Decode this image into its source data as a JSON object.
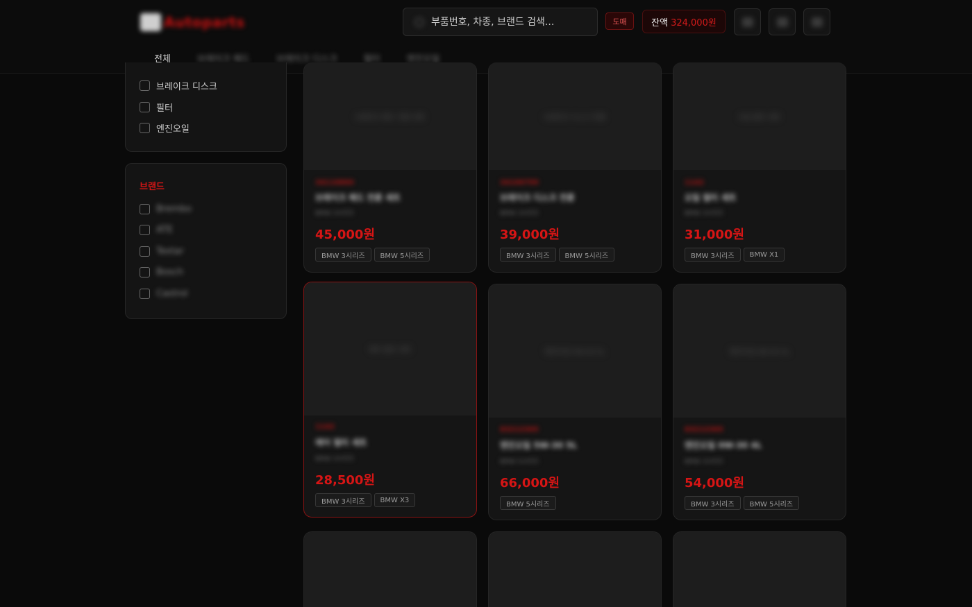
{
  "header": {
    "logo_mark": "XX",
    "logo_text": "Autoparts",
    "search_placeholder": "부품번호, 차종, 브랜드 검색...",
    "wholesale_badge": "도매",
    "balance_label": "잔액",
    "balance_value": "324,000원",
    "icon_buttons": [
      "cart-icon",
      "bell-icon",
      "user-icon"
    ]
  },
  "nav": {
    "tabs": [
      {
        "label": "전체",
        "blurred": false
      },
      {
        "label": "브레이크 패드",
        "blurred": true
      },
      {
        "label": "브레이크 디스크",
        "blurred": true
      },
      {
        "label": "필터",
        "blurred": true
      },
      {
        "label": "엔진오일",
        "blurred": true
      }
    ]
  },
  "sidebar": {
    "categories": [
      {
        "label": "브레이크 디스크"
      },
      {
        "label": "필터"
      },
      {
        "label": "엔진오일"
      }
    ],
    "brand_title": "브랜드",
    "brands": [
      {
        "label": "Brembo"
      },
      {
        "label": "ATE"
      },
      {
        "label": "Textar"
      },
      {
        "label": "Bosch"
      },
      {
        "label": "Castrol"
      }
    ]
  },
  "products": [
    {
      "sku": "34116860",
      "title": "브레이크 패드 전륜 세트",
      "sub": "BMW 3시리즈",
      "price": "45,000원",
      "tags": [
        "BMW 3시리즈",
        "BMW 5시리즈"
      ]
    },
    {
      "sku": "34106799",
      "title": "브레이크 디스크 전륜",
      "sub": "BMW 3시리즈",
      "price": "39,000원",
      "tags": [
        "BMW 3시리즈",
        "BMW 5시리즈"
      ]
    },
    {
      "sku": "1142",
      "title": "오일 필터 세트",
      "sub": "BMW 3시리즈",
      "price": "31,000원",
      "tags": [
        "BMW 3시리즈",
        "BMW X1"
      ]
    },
    {
      "sku": "1142",
      "title": "에어 필터 세트",
      "sub": "BMW 3시리즈",
      "price": "28,500원",
      "tags": [
        "BMW 3시리즈",
        "BMW X3"
      ],
      "selected": true
    },
    {
      "sku": "83212365",
      "title": "엔진오일 5W-30 5L",
      "sub": "BMW 5시리즈",
      "price": "66,000원",
      "tags": [
        "BMW 5시리즈"
      ]
    },
    {
      "sku": "83212365",
      "title": "엔진오일 0W-30 4L",
      "sub": "BMW 3시리즈",
      "price": "54,000원",
      "tags": [
        "BMW 3시리즈",
        "BMW 5시리즈"
      ]
    },
    {
      "sku": "",
      "title": "",
      "sub": "",
      "price": "",
      "tags": []
    },
    {
      "sku": "",
      "title": "",
      "sub": "",
      "price": "",
      "tags": []
    },
    {
      "sku": "",
      "title": "",
      "sub": "",
      "price": "",
      "tags": []
    }
  ]
}
